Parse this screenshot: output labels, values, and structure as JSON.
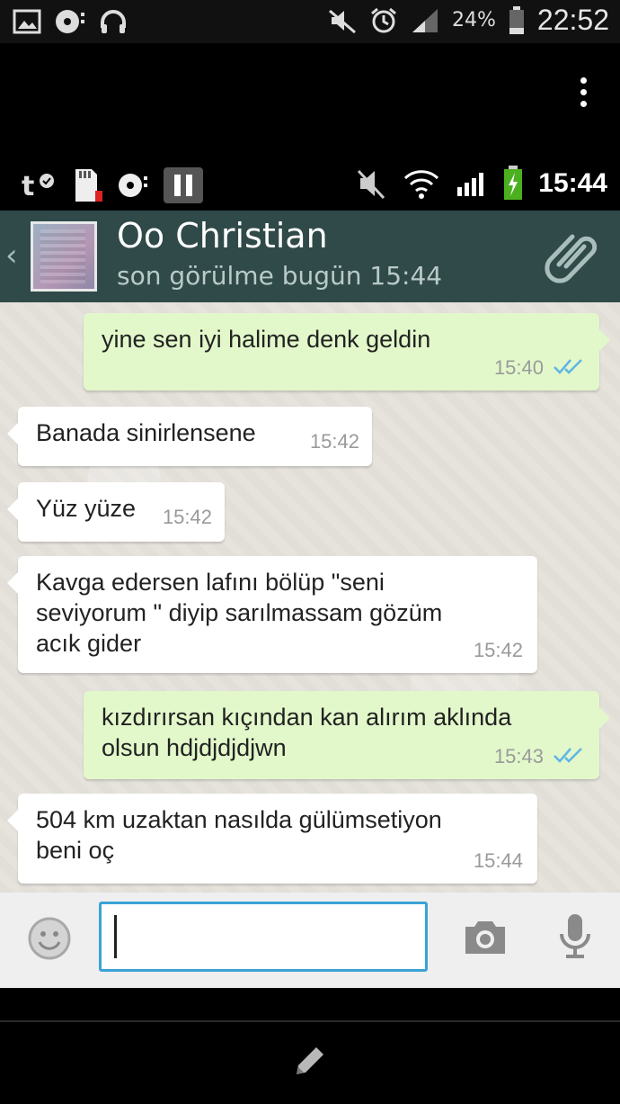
{
  "outer_status": {
    "battery_percent": "24%",
    "time": "22:52",
    "icons": [
      "gallery-icon",
      "music-disc-icon",
      "headphones-icon",
      "mute-icon",
      "alarm-icon",
      "signal-icon",
      "battery-icon"
    ]
  },
  "inner_status": {
    "time": "15:44",
    "icons": [
      "t-mobile-icon",
      "sd-card-icon",
      "music-disc-icon",
      "pause-icon",
      "mute-icon",
      "wifi-icon",
      "signal-icon",
      "battery-charging-icon"
    ]
  },
  "chat_header": {
    "contact_name": "Oo Christian",
    "last_seen": "son görülme bugün 15:44",
    "back_icon": "chevron-left-icon",
    "attach_icon": "paperclip-icon"
  },
  "messages": [
    {
      "direction": "out",
      "text": "yine sen iyi halime denk geldin",
      "time": "15:40",
      "status": "read"
    },
    {
      "direction": "in",
      "text": "Banada sinirlensene",
      "time": "15:42"
    },
    {
      "direction": "in",
      "text": "Yüz yüze",
      "time": "15:42"
    },
    {
      "direction": "in",
      "text": "Kavga edersen lafını bölüp \"seni\nseviyorum \" diyip sarılmassam gözüm\nacık gider",
      "time": "15:42"
    },
    {
      "direction": "out",
      "text": "kızdırırsan kıçından kan alırım aklında\nolsun hdjdjdjdjwn",
      "time": "15:43",
      "status": "read"
    },
    {
      "direction": "in",
      "text": "504 km uzaktan nasılda gülümsetiyon\nbeni oç",
      "time": "15:44"
    }
  ],
  "input_bar": {
    "emoji_icon": "smiley-icon",
    "message_value": "",
    "camera_icon": "camera-icon",
    "mic_icon": "microphone-icon"
  },
  "bottom": {
    "edit_icon": "pencil-icon"
  },
  "colors": {
    "header": "#2f4a48",
    "bubble_in": "#ffffff",
    "bubble_out": "#e2f8ca",
    "read_ticks": "#5fb5e6",
    "input_border": "#3ba3d6"
  }
}
